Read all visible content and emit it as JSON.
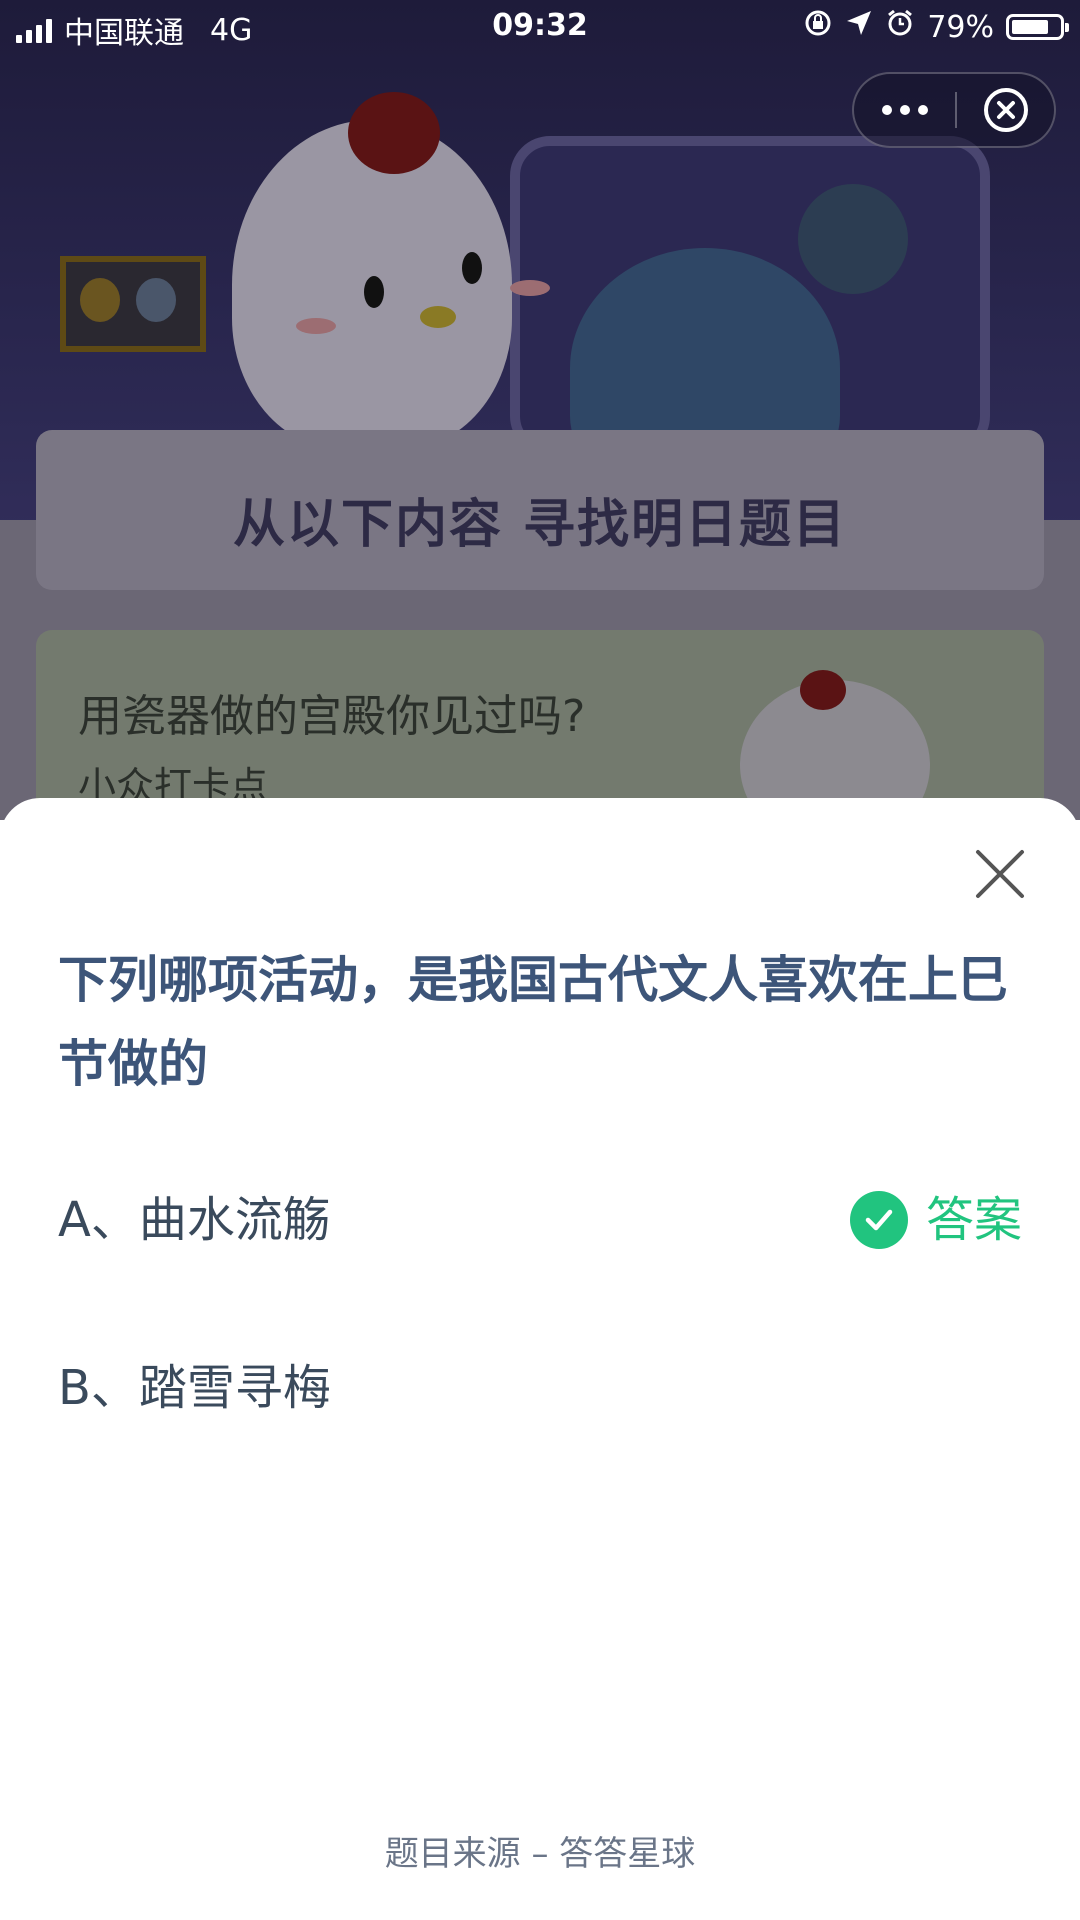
{
  "status_bar": {
    "carrier": "中国联通",
    "network": "4G",
    "time": "09:32",
    "battery": "79%",
    "battery_level": 0.79
  },
  "capsule": {
    "more_icon": "more-dots-icon",
    "close_icon": "circle-close-icon"
  },
  "background": {
    "banner_title": "从以下内容  寻找明日题目",
    "card_title": "用瓷器做的宫殿你见过吗?",
    "card_subtitle": "小众打卡点"
  },
  "sheet": {
    "question": "下列哪项活动，是我国古代文人喜欢在上巳节做的",
    "options": [
      {
        "label": "A、曲水流觞",
        "is_answer": true
      },
      {
        "label": "B、踏雪寻梅",
        "is_answer": false
      }
    ],
    "answer_label": "答案",
    "footer": "题目来源 – 答答星球"
  },
  "colors": {
    "accent_green": "#21c47f",
    "question_blue": "#3d5579",
    "option_text": "#3a4a5c"
  }
}
